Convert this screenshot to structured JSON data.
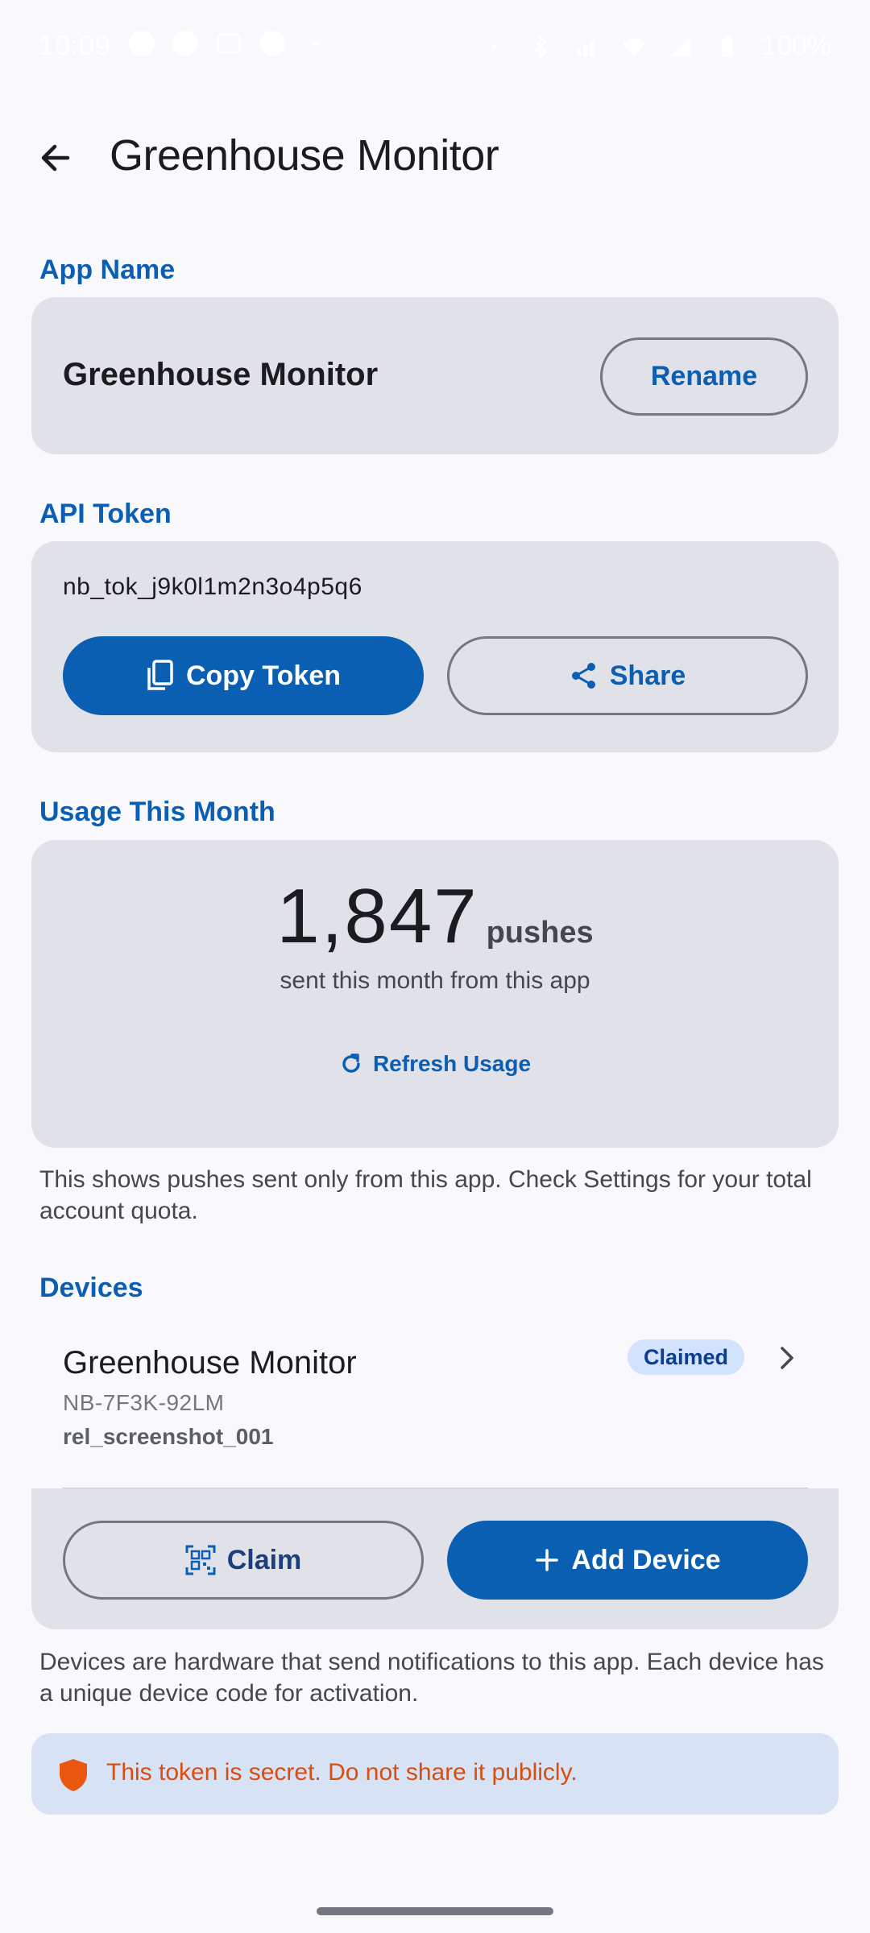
{
  "status_bar": {
    "time": "10:09",
    "battery": "100%",
    "icons_left": [
      "sync-icon",
      "info-icon",
      "image-icon",
      "info-icon",
      "dot-icon"
    ],
    "icons_right": [
      "vibrate-icon",
      "bluetooth-icon",
      "signal-icon",
      "wifi-icon",
      "cellular-icon",
      "battery-icon"
    ]
  },
  "header": {
    "title": "Greenhouse Monitor"
  },
  "app_name_section": {
    "label": "App Name",
    "value": "Greenhouse Monitor",
    "rename_label": "Rename"
  },
  "api_token_section": {
    "label": "API Token",
    "token": "nb_tok_j9k0l1m2n3o4p5q6",
    "copy_label": "Copy Token",
    "share_label": "Share"
  },
  "usage_section": {
    "label": "Usage This Month",
    "count": "1,847",
    "unit": "pushes",
    "subtitle": "sent this month from this app",
    "refresh_label": "Refresh Usage",
    "helper": "This shows pushes sent only from this app. Check Settings for your total account quota."
  },
  "devices_section": {
    "label": "Devices",
    "items": [
      {
        "name": "Greenhouse Monitor",
        "code": "NB-7F3K-92LM",
        "ref": "rel_screenshot_001",
        "status": "Claimed"
      }
    ],
    "claim_label": "Claim",
    "add_label": "Add Device",
    "helper": "Devices are hardware that send notifications to this app. Each device has a unique device code for activation."
  },
  "warning": {
    "text": "This token is secret. Do not share it publicly."
  },
  "colors": {
    "accent": "#0b5fb3",
    "card": "#e1e2e9",
    "warning": "#d84e0e",
    "badge": "#d3e3fd"
  }
}
